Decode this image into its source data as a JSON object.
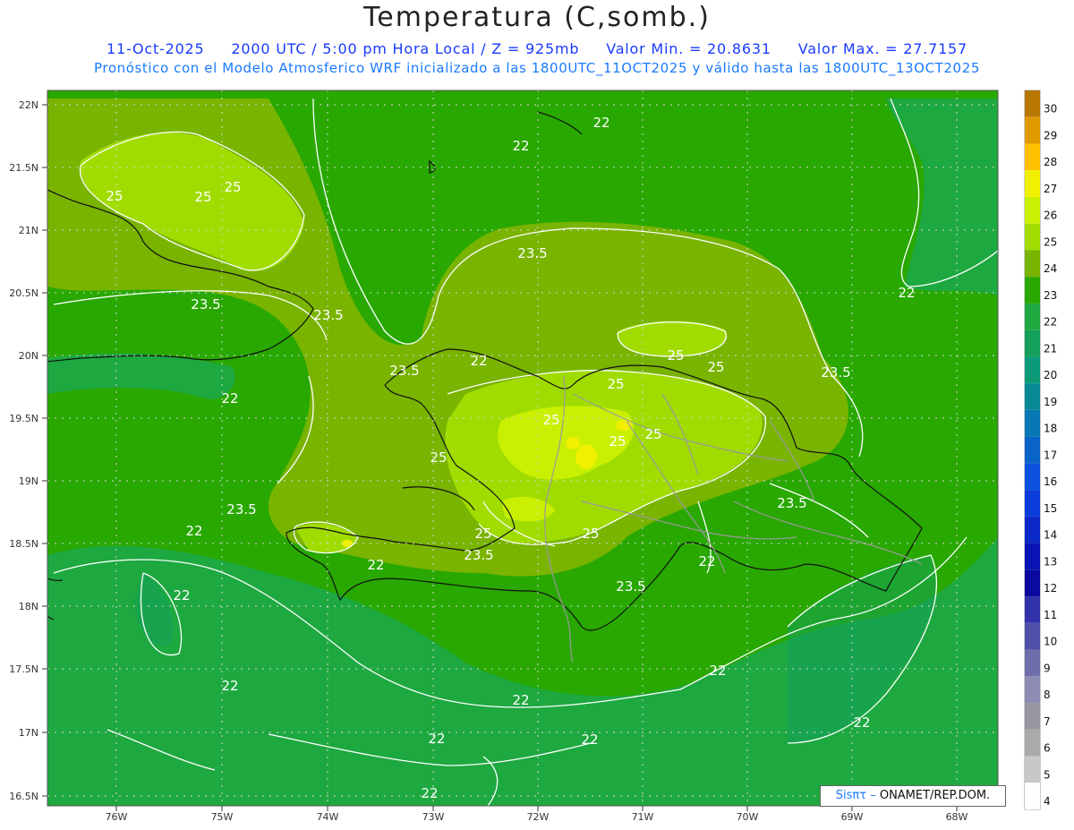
{
  "header": {
    "title": "Temperatura (C,somb.)",
    "date": "11-Oct-2025",
    "time": "2000 UTC / 5:00 pm Hora Local / Z = 925mb",
    "min": "Valor Min. = 20.8631",
    "max": "Valor Max. = 27.7157",
    "subtitle": "Pronóstico con el Modelo Atmosferico WRF inicializado a las 1800UTC_11OCT2025 y válido hasta las  1800UTC_13OCT2025"
  },
  "map": {
    "lat_labels": [
      "22N",
      "21.5N",
      "21N",
      "20.5N",
      "20N",
      "19.5N",
      "19N",
      "18.5N",
      "18N",
      "17.5N",
      "17N",
      "16.5N"
    ],
    "lon_labels": [
      "76W",
      "75W",
      "74W",
      "73W",
      "72W",
      "71W",
      "70W",
      "69W",
      "68W"
    ],
    "contour_labels": [
      "25",
      "25",
      "25",
      "23.5",
      "23.5",
      "23.5",
      "22",
      "22",
      "22",
      "22",
      "22",
      "22",
      "22",
      "22",
      "22",
      "22",
      "22",
      "22",
      "25",
      "25",
      "25",
      "25",
      "25",
      "25",
      "23.5",
      "23.5",
      "23.5",
      "23.5",
      "23.5",
      "22",
      "22",
      "25",
      "25",
      "25",
      "23.5",
      "22",
      "22"
    ]
  },
  "colorbar": {
    "levels": [
      "30",
      "29",
      "28",
      "27",
      "26",
      "25",
      "24",
      "23",
      "22",
      "21",
      "20",
      "19",
      "18",
      "17",
      "16",
      "15",
      "14",
      "13",
      "12",
      "11",
      "10",
      "9",
      "8",
      "7",
      "6",
      "5",
      "4"
    ],
    "colors": [
      "#b87800",
      "#e09a00",
      "#ffc000",
      "#f0f000",
      "#c8f000",
      "#a0dc00",
      "#78b400",
      "#28a800",
      "#1ea840",
      "#14a05a",
      "#0a9a78",
      "#088a96",
      "#0878b4",
      "#0a64c8",
      "#0a50dc",
      "#0a3cdc",
      "#0a28c8",
      "#0a14b4",
      "#0a0aa0",
      "#3232aa",
      "#5050aa",
      "#6e6eaa",
      "#8c8cb4",
      "#9696a0",
      "#aaaaaa",
      "#c8c8c8",
      "#ffffff"
    ]
  },
  "credit": {
    "brand": "Sisπτ –",
    "org": " ONAMET/REP.DOM."
  }
}
